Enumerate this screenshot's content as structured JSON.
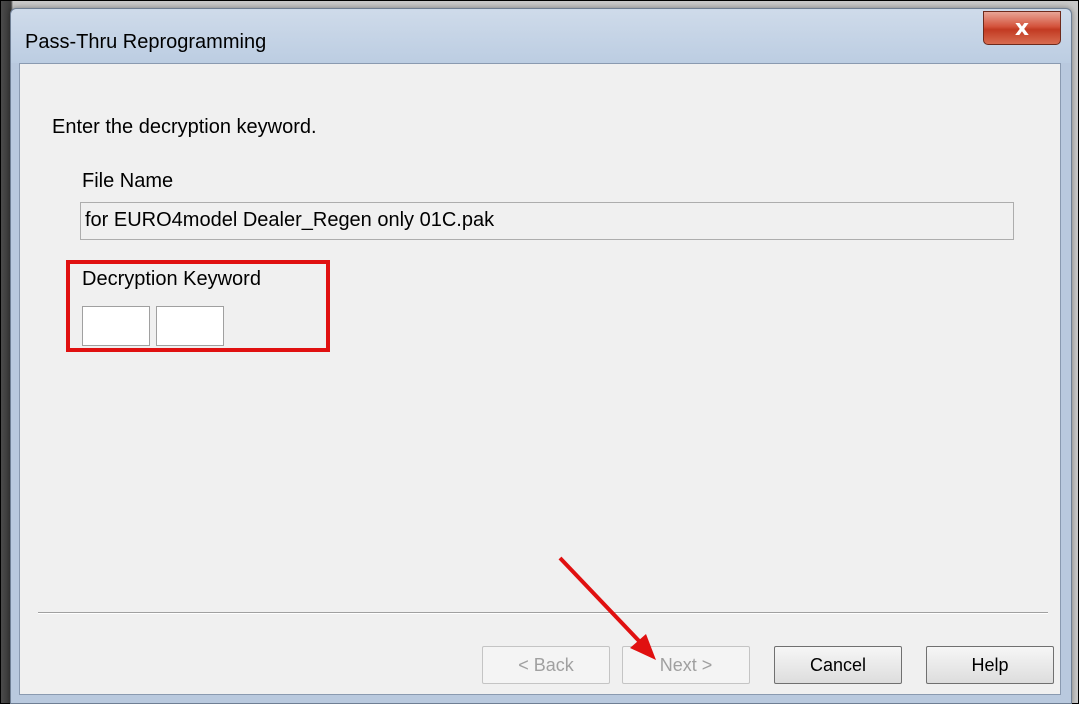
{
  "window": {
    "title": "Pass-Thru Reprogramming",
    "close_glyph": "x"
  },
  "content": {
    "instruction": "Enter the decryption keyword.",
    "file_name_label": "File Name",
    "file_name_value": "for EURO4model Dealer_Regen only 01C.pak",
    "keyword_label": "Decryption Keyword",
    "keyword_part1": "",
    "keyword_part2": ""
  },
  "buttons": {
    "back": "< Back",
    "next": "Next >",
    "cancel": "Cancel",
    "help": "Help"
  },
  "annotations": {
    "highlight_color": "#e01010",
    "arrow_color": "#e01010"
  },
  "icons": {
    "close": "close-icon",
    "arrow": "arrow-annotation"
  }
}
